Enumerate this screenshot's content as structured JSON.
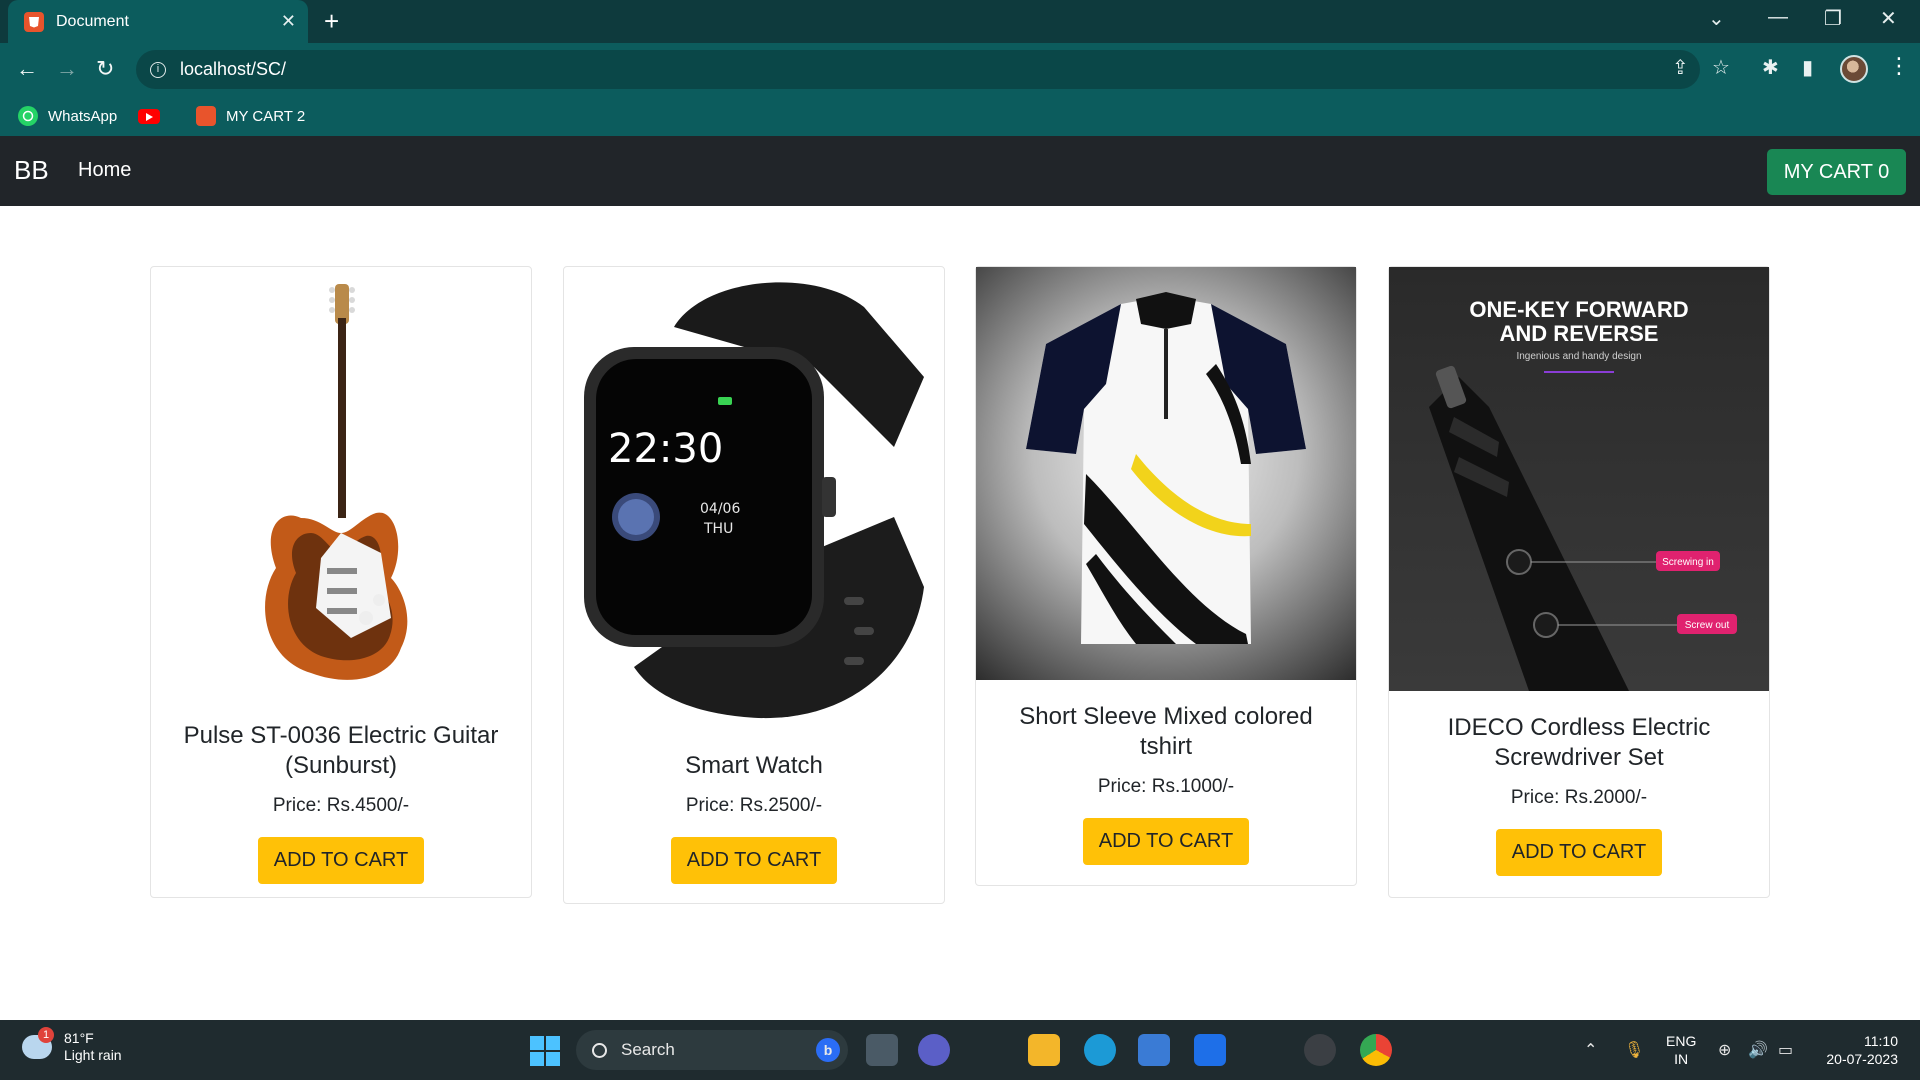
{
  "browser": {
    "tab_title": "Document",
    "tab_close": "✕",
    "new_tab": "+",
    "url": "localhost/SC/",
    "bookmarks": [
      "WhatsApp",
      "MY CART 2"
    ]
  },
  "site": {
    "brand": "BB",
    "nav_home": "Home",
    "cart_button": "MY CART 0"
  },
  "products": [
    {
      "name": "Pulse ST-0036 Electric Guitar (Sunburst)",
      "price": "Price: Rs.4500/-",
      "button": "ADD TO CART"
    },
    {
      "name": "Smart Watch",
      "price": "Price: Rs.2500/-",
      "button": "ADD TO CART"
    },
    {
      "name": "Short Sleeve Mixed colored tshirt",
      "price": "Price: Rs.1000/-",
      "button": "ADD TO CART"
    },
    {
      "name": "IDECO Cordless Electric Screwdriver Set",
      "price": "Price: Rs.2000/-",
      "button": "ADD TO CART"
    }
  ],
  "product_images": {
    "watch_time": "22:30",
    "watch_date": "04/06",
    "watch_day": "THU",
    "screwdriver_headline_1": "ONE-KEY FORWARD",
    "screwdriver_headline_2": "AND REVERSE",
    "screwdriver_sub": "Ingenious and handy design",
    "screwdriver_tag_in": "Screwing in",
    "screwdriver_tag_out": "Screw out"
  },
  "taskbar": {
    "weather_temp": "81°F",
    "weather_desc": "Light rain",
    "weather_badge": "1",
    "search_label": "Search",
    "lang_1": "ENG",
    "lang_2": "IN",
    "time": "11:10",
    "date": "20-07-2023"
  },
  "colors": {
    "browser_frame": "#0c5c5d",
    "navbar": "#212529",
    "cart_button": "#198754",
    "add_button": "#ffc107"
  }
}
